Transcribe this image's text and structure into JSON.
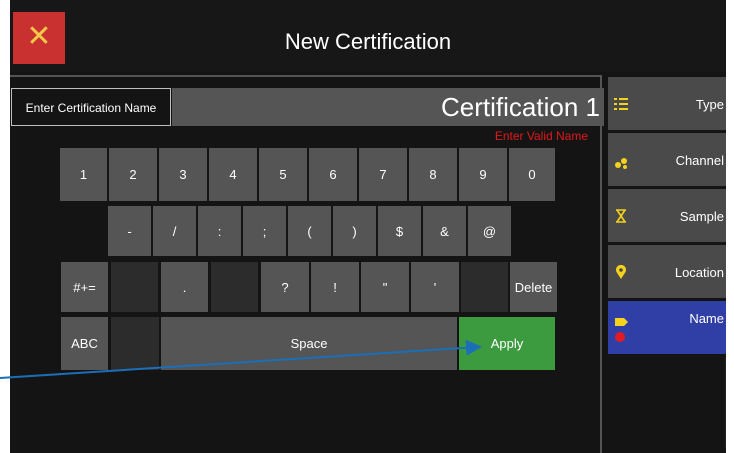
{
  "titlebar": {
    "title": "New Certification",
    "close_icon": "close-icon",
    "close_glyph": "✕"
  },
  "name_entry": {
    "label": "Enter Certification Name",
    "value": "Certification 1",
    "error": "Enter Valid Name"
  },
  "keyboard": {
    "row1": [
      "1",
      "2",
      "3",
      "4",
      "5",
      "6",
      "7",
      "8",
      "9",
      "0"
    ],
    "row2": [
      "-",
      "/",
      ":",
      ";",
      "(",
      ")",
      "$",
      "&",
      "@"
    ],
    "row3": {
      "mode": "#+=",
      "dot": ".",
      "question": "?",
      "exclaim": "!",
      "dquote": "\"",
      "squote": "'",
      "delete": "Delete"
    },
    "row4": {
      "abc": "ABC",
      "space": "Space",
      "apply": "Apply"
    }
  },
  "sidebar": {
    "items": [
      {
        "label": "Type",
        "icon": "list-icon",
        "icon_color": "#f5d21e"
      },
      {
        "label": "Channel",
        "icon": "dots-icon",
        "icon_color": "#f5d21e"
      },
      {
        "label": "Sample",
        "icon": "hourglass-icon",
        "icon_color": "#f5d21e"
      },
      {
        "label": "Location",
        "icon": "map-pin-icon",
        "icon_color": "#f5d21e"
      },
      {
        "label": "Name",
        "icon": "tag-icon",
        "icon_color": "#f5d21e",
        "badge_color": "#e01b24",
        "active": true
      }
    ]
  },
  "colors": {
    "accent_active": "#2f3fa5",
    "apply": "#3d9b3f",
    "close": "#c8312f",
    "error": "#e0191c",
    "annotation_arrow": "#1a6fb8"
  }
}
